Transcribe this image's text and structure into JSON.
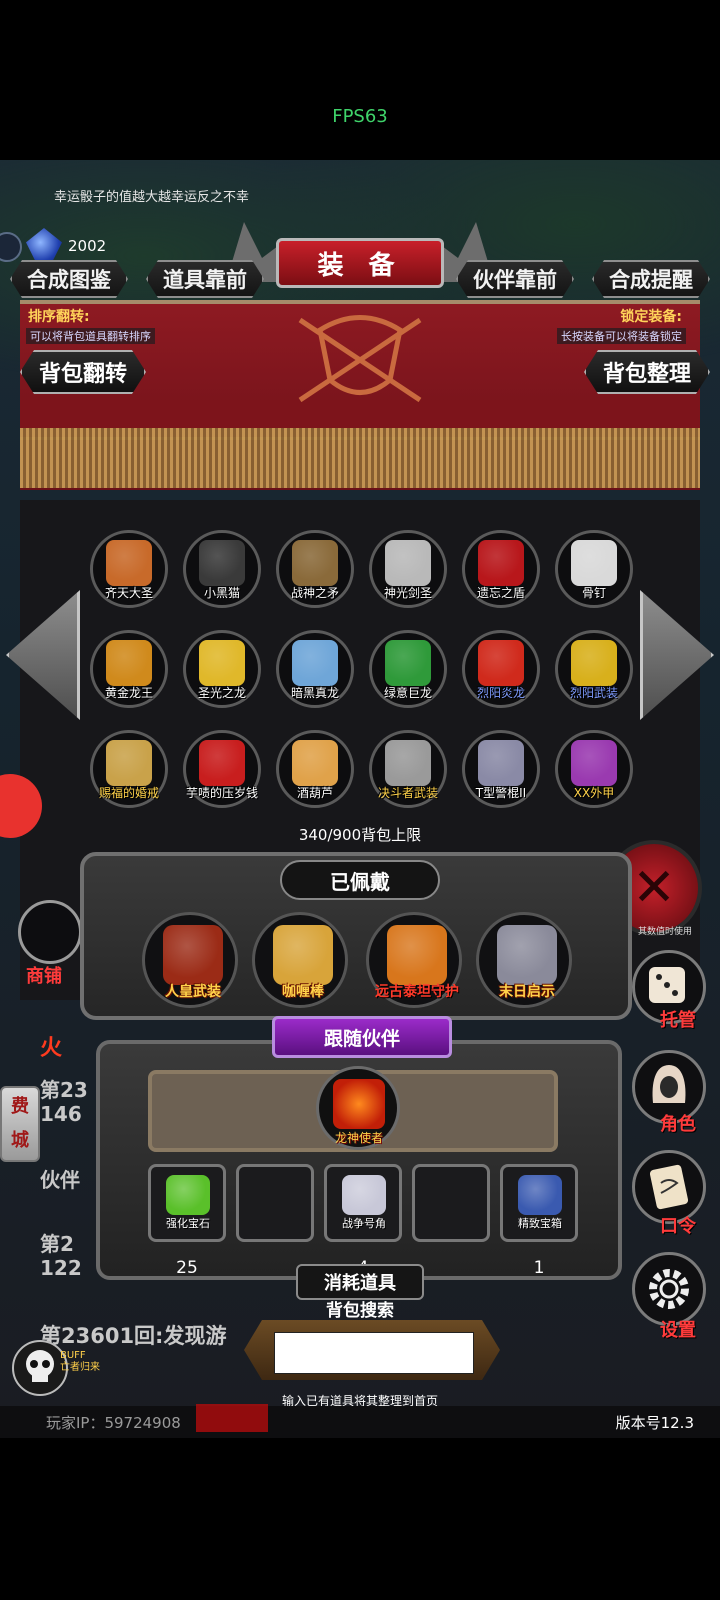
{
  "fps": "FPS63",
  "luck_text": "幸运骰子的值越大越幸运反之不幸",
  "gem_count": "2002",
  "tabs": {
    "left1": "合成图鉴",
    "left2": "道具靠前",
    "title": "装 备",
    "right1": "伙伴靠前",
    "right2": "合成提醒"
  },
  "sort_flip": {
    "label": "排序翻转:",
    "hint": "可以将背包道具翻转排序",
    "button": "背包翻转"
  },
  "lock_equip": {
    "label": "锁定装备:",
    "hint": "长按装备可以将装备锁定",
    "button": "背包整理"
  },
  "bag_items": [
    {
      "name": "齐天大圣",
      "color": "white",
      "icon": "monkey-king-icon",
      "tint": "#c86a2a"
    },
    {
      "name": "小黑猫",
      "color": "white",
      "icon": "black-cat-icon",
      "tint": "#3a3a3a"
    },
    {
      "name": "战神之矛",
      "color": "white",
      "icon": "spear-icon",
      "tint": "#8a6a3a"
    },
    {
      "name": "神光剑圣",
      "color": "white",
      "icon": "sword-saint-icon",
      "tint": "#b9b9b9"
    },
    {
      "name": "遗忘之盾",
      "color": "white",
      "icon": "shield-icon",
      "tint": "#b8171b"
    },
    {
      "name": "骨钉",
      "color": "white",
      "icon": "bone-nail-icon",
      "tint": "#d9d9d9"
    },
    {
      "name": "黄金龙王",
      "color": "white",
      "icon": "gold-dragon-icon",
      "tint": "#d08a1c"
    },
    {
      "name": "圣光之龙",
      "color": "white",
      "icon": "holy-dragon-icon",
      "tint": "#e0b82a"
    },
    {
      "name": "暗黑真龙",
      "color": "white",
      "icon": "dark-dragon-icon",
      "tint": "#6fa6d8"
    },
    {
      "name": "绿意巨龙",
      "color": "white",
      "icon": "green-dragon-icon",
      "tint": "#2f9a3a"
    },
    {
      "name": "烈阳炎龙",
      "color": "blue",
      "icon": "fire-dragon-icon",
      "tint": "#d02a1c"
    },
    {
      "name": "烈阳武装",
      "color": "blue",
      "icon": "sun-armor-icon",
      "tint": "#d8b01c"
    },
    {
      "name": "赐福的婚戒",
      "color": "yellow",
      "icon": "ring-icon",
      "tint": "#c9a24a"
    },
    {
      "name": "芋啧的压岁钱",
      "color": "white",
      "icon": "red-envelope-icon",
      "tint": "#c81e1e"
    },
    {
      "name": "酒葫芦",
      "color": "white",
      "icon": "gourd-icon",
      "tint": "#e0a24a"
    },
    {
      "name": "决斗者武装",
      "color": "yellow",
      "icon": "duelist-armor-icon",
      "tint": "#9a9a9a"
    },
    {
      "name": "T型警棍II",
      "color": "white",
      "icon": "baton-icon",
      "tint": "#8a8aa6"
    },
    {
      "name": "XX外甲",
      "color": "yellow",
      "icon": "mech-armor-icon",
      "tint": "#9a3ab0"
    }
  ],
  "capacity": "340/900背包上限",
  "equipped": {
    "title": "已佩戴",
    "items": [
      {
        "name": "人皇武装",
        "style": "yellow",
        "icon": "emperor-armor-icon",
        "tint": "#9b2b16"
      },
      {
        "name": "咖喱棒",
        "style": "yellow",
        "icon": "golden-sword-icon",
        "tint": "#d8a43a"
      },
      {
        "name": "远古泰坦守护",
        "style": "red",
        "icon": "titan-guard-icon",
        "tint": "#d8761c"
      },
      {
        "name": "末日启示",
        "style": "yellow",
        "icon": "doom-blade-icon",
        "tint": "#8a8a9a"
      }
    ]
  },
  "partner": {
    "title": "跟随伙伴",
    "name": "龙神使者",
    "icon": "dragon-envoy-icon"
  },
  "consumables": {
    "title": "消耗道具",
    "items": [
      {
        "name": "强化宝石",
        "count": "25",
        "icon": "enhance-gem-icon",
        "tint": "#5ac02a"
      },
      {
        "name": "",
        "count": "",
        "icon": "",
        "tint": ""
      },
      {
        "name": "战争号角",
        "count": "4",
        "icon": "war-horn-icon",
        "tint": "#c8c8d8"
      },
      {
        "name": "",
        "count": "",
        "icon": "",
        "tint": ""
      },
      {
        "name": "精致宝箱",
        "count": "1",
        "icon": "treasure-chest-icon",
        "tint": "#3a5ab0"
      }
    ]
  },
  "search": {
    "label": "背包搜索",
    "value": "",
    "hint": "输入已有道具将其整理到首页"
  },
  "side": {
    "shop": "商铺",
    "fee_line1": "费",
    "fee_line2": "城",
    "manage": "托管",
    "role": "角色",
    "code": "口令",
    "settings": "设置",
    "percent_note": "其数值时使用"
  },
  "log": {
    "fire": "火",
    "round_a": "第23",
    "num_a": "146",
    "partner": "伙伴",
    "round_b": "第2",
    "num_b": "122",
    "found": "第23601回:发现游"
  },
  "buff": {
    "label": "BUFF",
    "sub": "亡者归来"
  },
  "player_ip": "玩家IP：59724908",
  "version": "版本号12.3",
  "colors": {
    "accent_red": "#c8202a",
    "gold": "#ffd24a",
    "fps_green": "#3fd36a"
  }
}
